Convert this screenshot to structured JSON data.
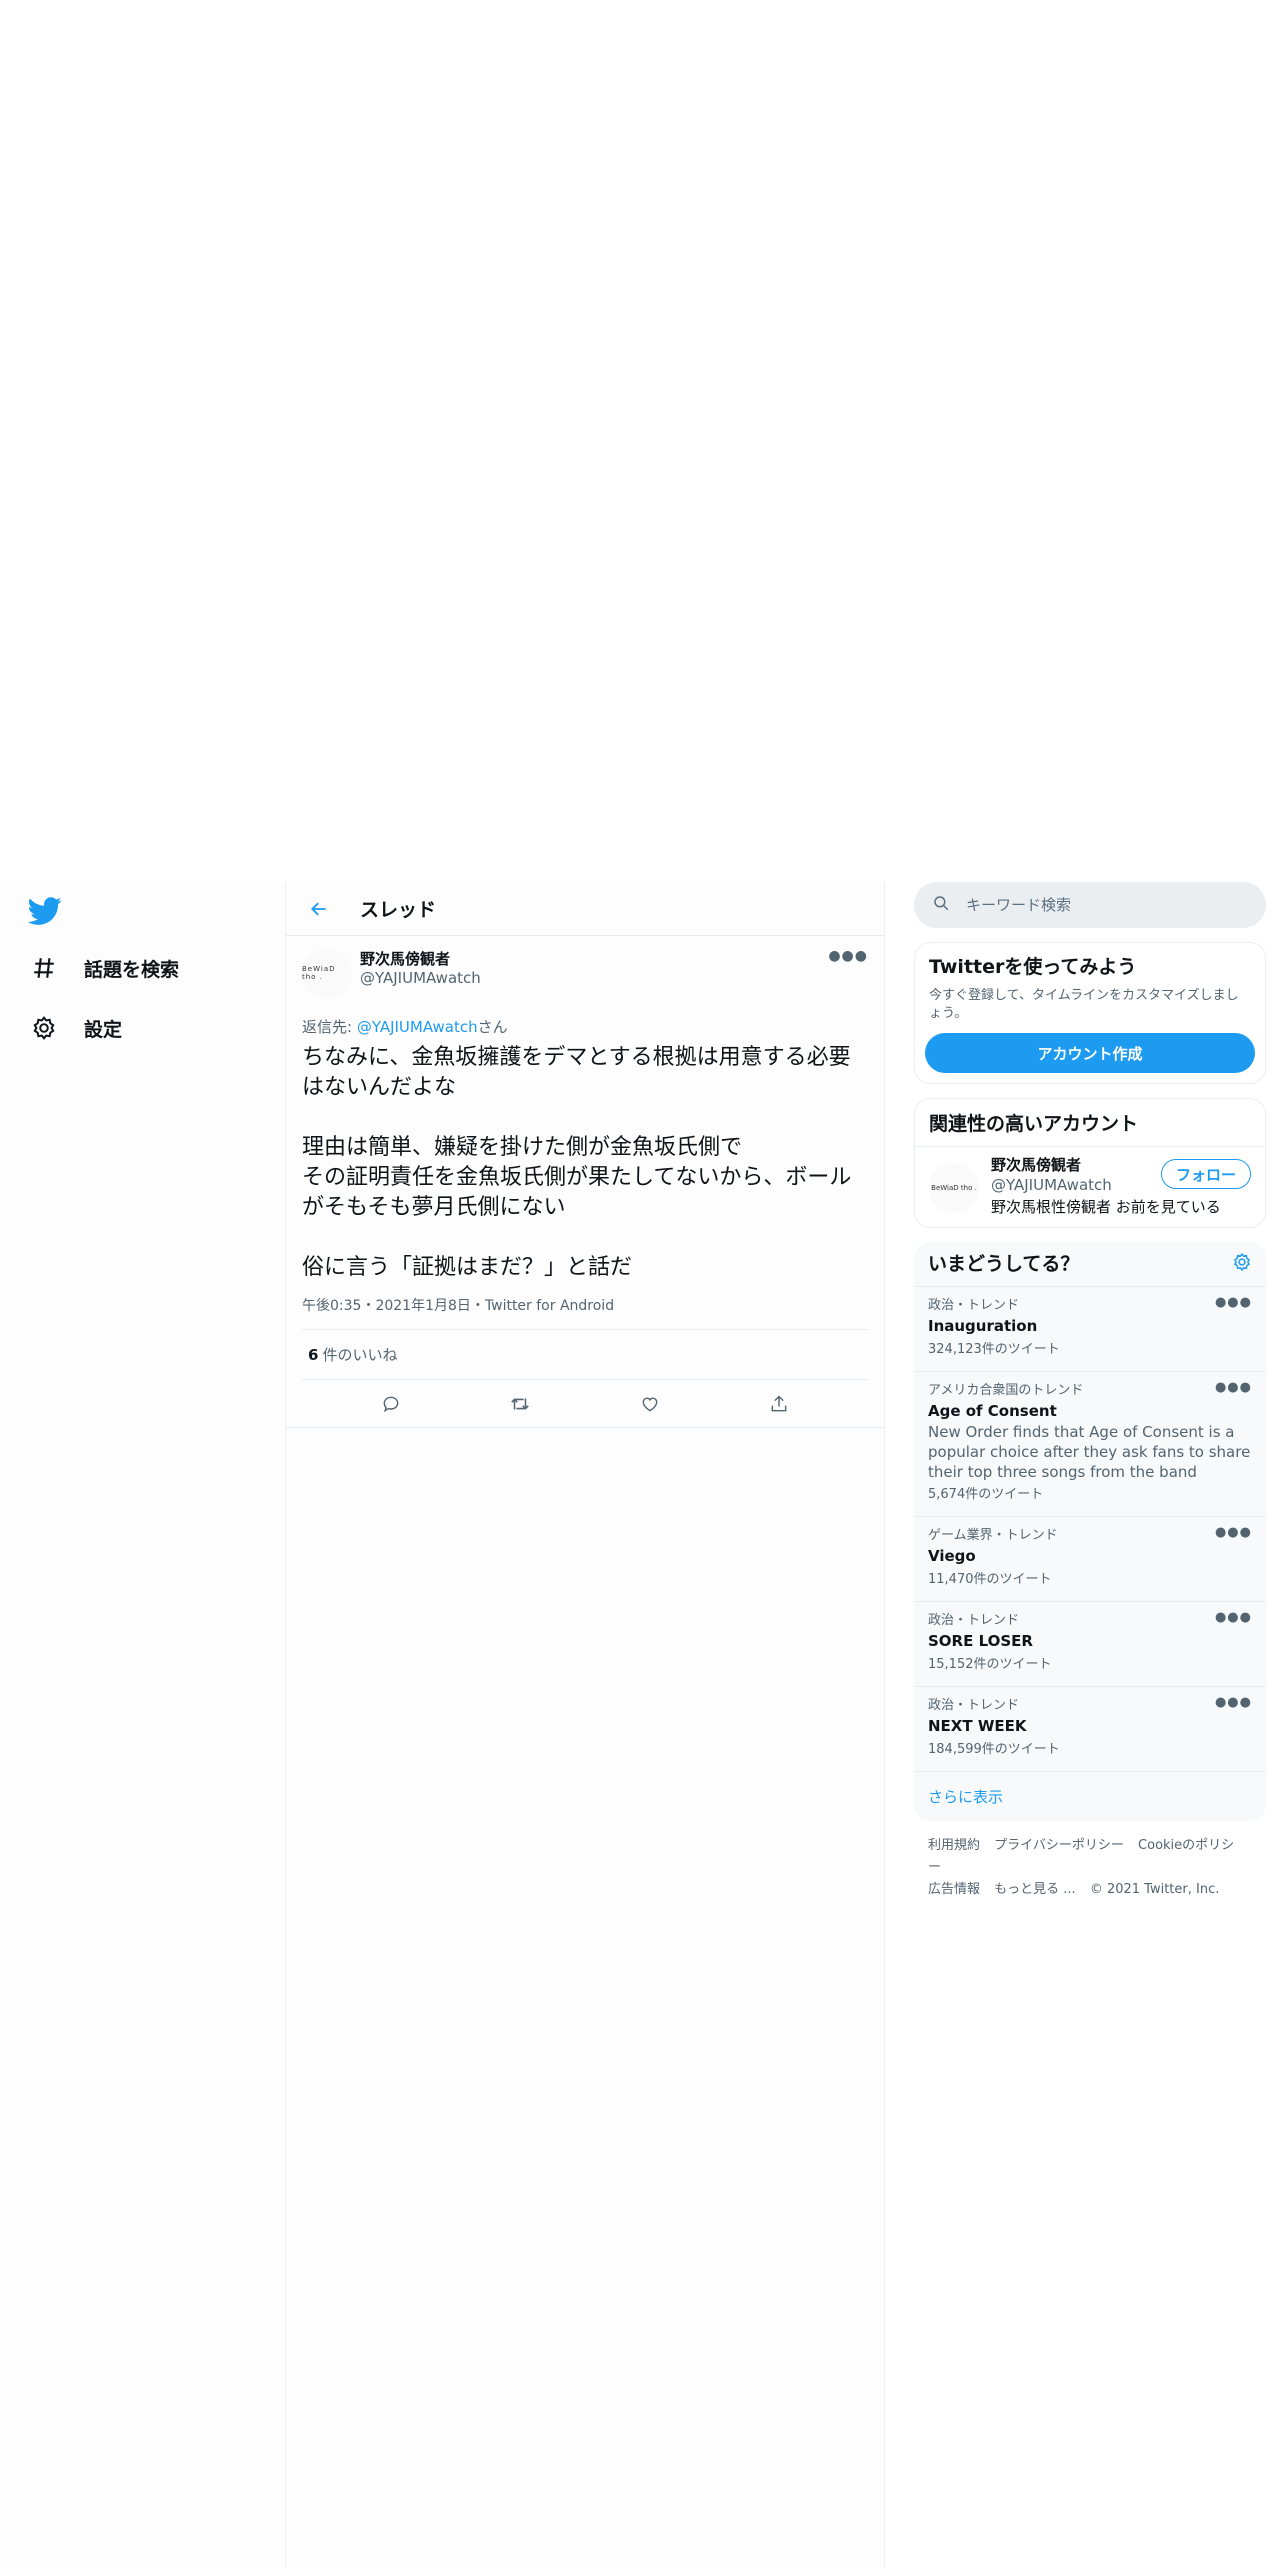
{
  "nav": {
    "items": [
      {
        "label": "話題を検索",
        "icon": "hashtag-icon"
      },
      {
        "label": "設定",
        "icon": "gear-icon"
      }
    ]
  },
  "header": {
    "title": "スレッド"
  },
  "tweet": {
    "display_name": "野次馬傍観者",
    "handle": "@YAJIUMAwatch",
    "reply_prefix": "返信先: ",
    "reply_mention": "@YAJIUMAwatch",
    "reply_suffix": "さん",
    "text": "ちなみに、金魚坂擁護をデマとする根拠は用意する必要はないんだよな\n\n理由は簡単、嫌疑を掛けた側が金魚坂氏側で\nその証明責任を金魚坂氏側が果たしてないから、ボールがそもそも夢月氏側にない\n\n俗に言う「証拠はまだ？」と話だ",
    "meta": "午後0:35・2021年1月8日・Twitter for Android",
    "likes_count": "6",
    "likes_label": "件のいいね",
    "avatar_text": "BeWiaD tho ."
  },
  "search": {
    "placeholder": "キーワード検索"
  },
  "signup": {
    "title": "Twitterを使ってみよう",
    "subtitle": "今すぐ登録して、タイムラインをカスタマイズしましょう。",
    "button": "アカウント作成"
  },
  "related": {
    "title": "関連性の高いアカウント",
    "name": "野次馬傍観者",
    "handle": "@YAJIUMAwatch",
    "bio": "野次馬根性傍観者 お前を見ている",
    "follow": "フォロー",
    "avatar_text": "BeWiaD tho ."
  },
  "trends": {
    "title": "いまどうしてる？",
    "items": [
      {
        "context": "政治・トレンド",
        "name": "Inauguration",
        "desc": "",
        "count": "324,123件のツイート"
      },
      {
        "context": "アメリカ合衆国のトレンド",
        "name": "Age of Consent",
        "desc": "New Order finds that Age of Consent is a popular choice after they ask fans to share their top three songs from the band",
        "count": "5,674件のツイート"
      },
      {
        "context": "ゲーム業界・トレンド",
        "name": "Viego",
        "desc": "",
        "count": "11,470件のツイート"
      },
      {
        "context": "政治・トレンド",
        "name": "SORE LOSER",
        "desc": "",
        "count": "15,152件のツイート"
      },
      {
        "context": "政治・トレンド",
        "name": "NEXT WEEK",
        "desc": "",
        "count": "184,599件のツイート"
      }
    ],
    "show_more": "さらに表示"
  },
  "footer": {
    "links": [
      "利用規約",
      "プライバシーポリシー",
      "Cookieのポリシー",
      "広告情報",
      "もっと見る ..."
    ],
    "copyright": "© 2021 Twitter, Inc."
  },
  "colors": {
    "accent": "#1d9bf0",
    "text": "#0f1419",
    "muted": "#536471"
  }
}
